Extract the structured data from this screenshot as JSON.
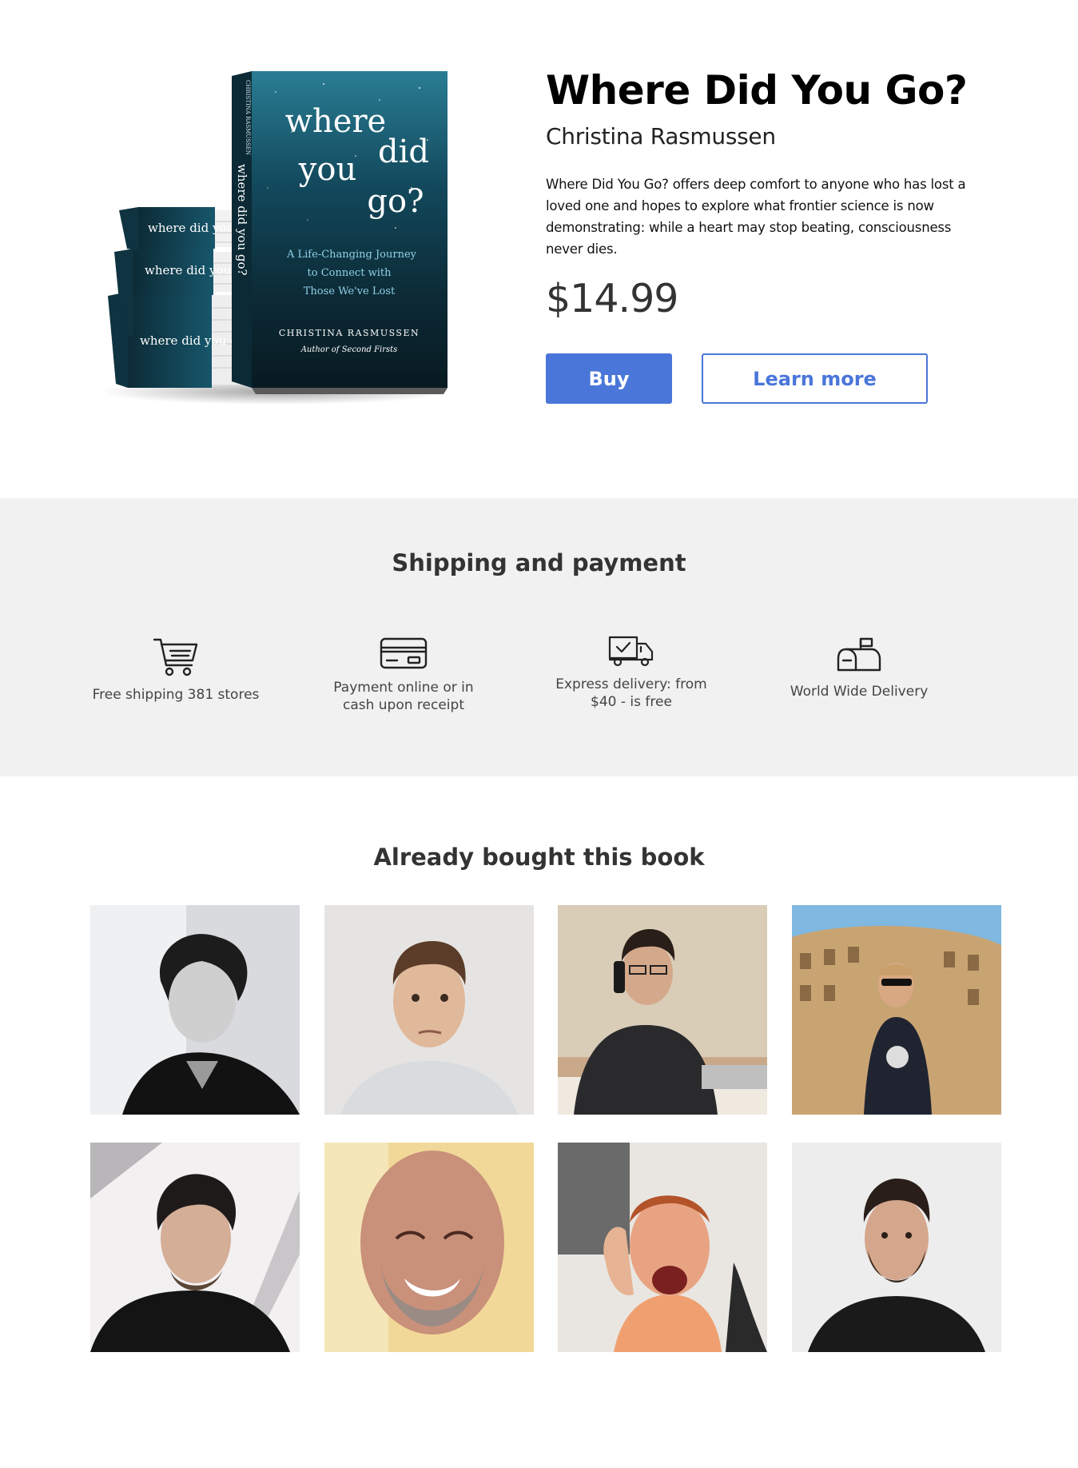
{
  "book": {
    "title": "Where Did You Go?",
    "author": "Christina Rasmussen",
    "description": "Where Did You Go? offers deep comfort to anyone who has lost a loved one and hopes to explore what frontier science is now demonstrating: while a heart may stop beating, consciousness never dies.",
    "price": "$14.99",
    "buy_label": "Buy",
    "learn_more_label": "Learn more",
    "cover": {
      "title_line1": "where",
      "title_line2": "did",
      "title_line3": "you",
      "title_line4": "go?",
      "subtitle_line1": "A Life-Changing Journey",
      "subtitle_line2": "to Connect with",
      "subtitle_line3": "Those We've Lost",
      "cover_author": "CHRISTINA RASMUSSEN",
      "cover_tagline": "Author of Second Firsts",
      "spine_text": "where did you go?",
      "spine_author": "CHRISTINA RASMUSSEN"
    }
  },
  "shipping": {
    "title": "Shipping and payment",
    "features": [
      {
        "icon": "shopping-cart-icon",
        "line1": "Free shipping 381 stores",
        "line2": ""
      },
      {
        "icon": "credit-card-icon",
        "line1": "Payment online or in",
        "line2": "cash upon receipt"
      },
      {
        "icon": "delivery-truck-icon",
        "line1": "Express delivery: from",
        "line2": "$40 - is free"
      },
      {
        "icon": "mailbox-icon",
        "line1": "World Wide Delivery",
        "line2": ""
      }
    ]
  },
  "buyers": {
    "title": "Already bought this book",
    "photos": [
      "man with tousled dark hair, black and white portrait",
      "man with short hair raising an eyebrow",
      "man in suit talking on phone at desk",
      "man in sunglasses at the Colosseum",
      "man with dark hair and stubble",
      "smiling bald man with grey beard",
      "excited man giving thumbs up",
      "man with dark beard in black t-shirt"
    ]
  },
  "colors": {
    "accent": "#4a76d9",
    "shipping_bg": "#f1f1f1",
    "cover_teal": "#14506a",
    "cover_dark": "#0b1e26"
  }
}
